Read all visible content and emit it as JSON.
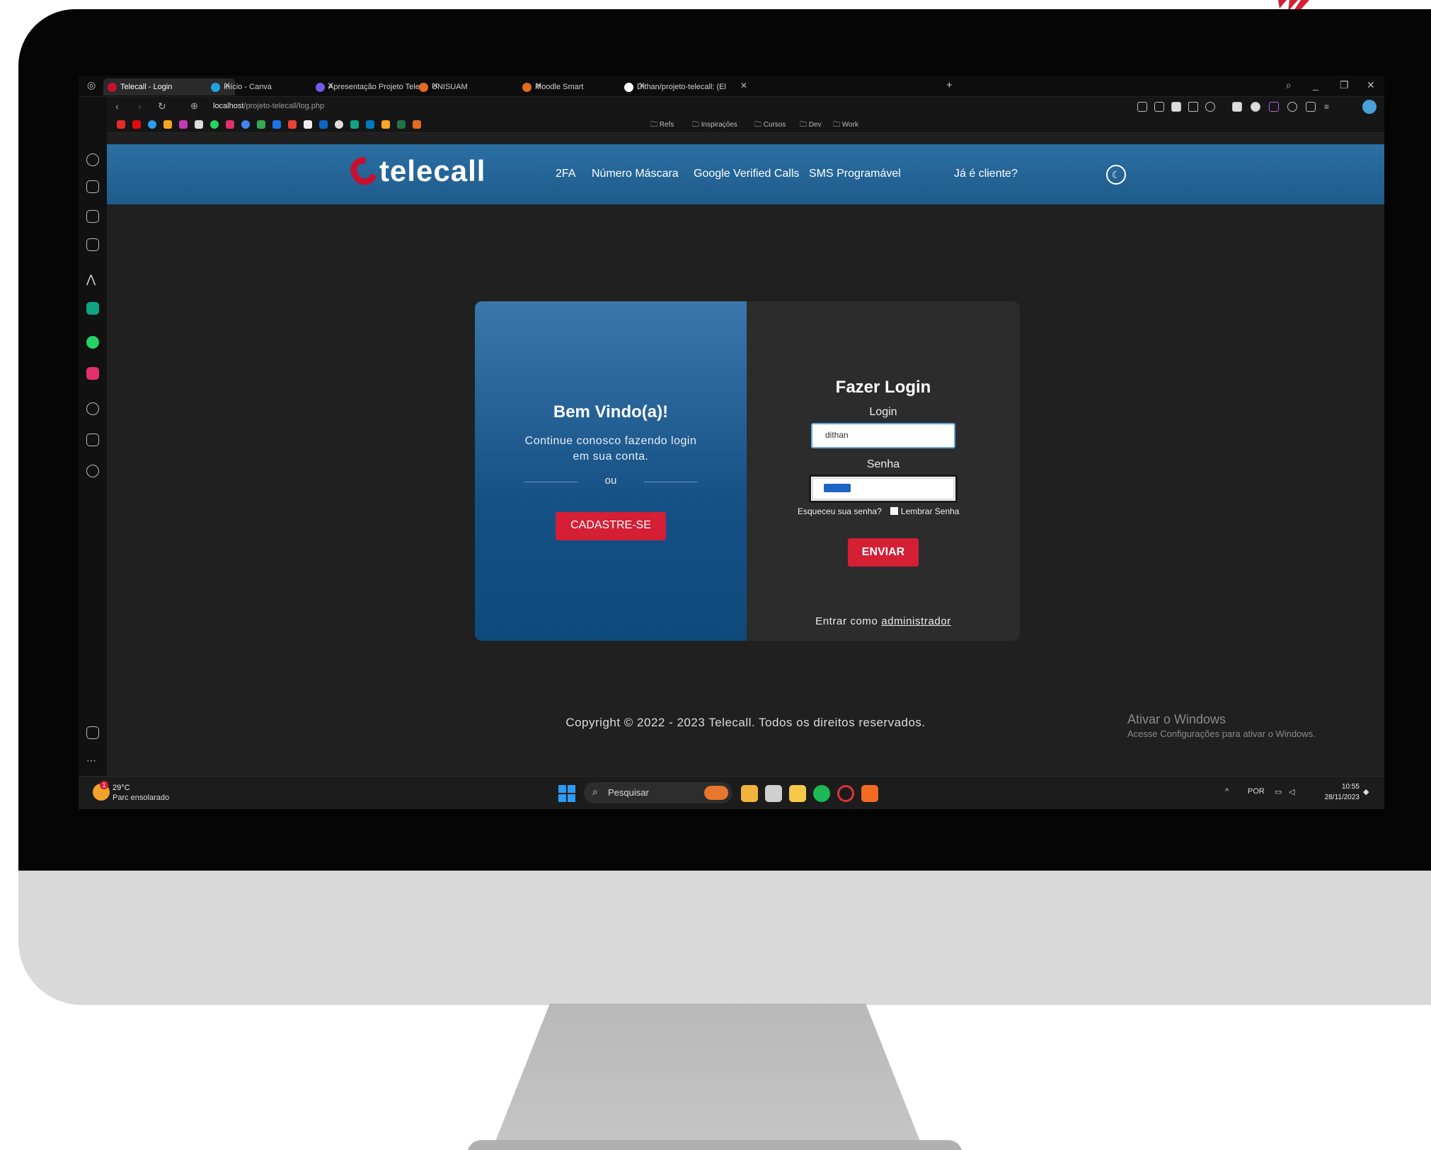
{
  "browser": {
    "tabs": [
      {
        "title": "Telecall - Login",
        "active": true,
        "favicon_color": "#c8102e"
      },
      {
        "title": "Início - Canva",
        "active": false,
        "favicon_color": "#1fa3e0"
      },
      {
        "title": "Apresentação Projeto Telec",
        "active": false,
        "favicon_color": "#6c5ce7"
      },
      {
        "title": "UNISUAM",
        "active": false,
        "favicon_color": "#e56b1f"
      },
      {
        "title": "Moodle Smart",
        "active": false,
        "favicon_color": "#e56b1f"
      },
      {
        "title": "Dithan/projeto-telecall: (El",
        "active": false,
        "favicon_color": "#ffffff"
      }
    ],
    "new_tab_glyph": "+",
    "url_host": "localhost",
    "url_path": "/projeto-telecall/log.php",
    "bookmark_folders": [
      "Refs",
      "Inspirações",
      "Cursos",
      "Dev",
      "Work"
    ]
  },
  "site": {
    "brand": "telecall",
    "nav": [
      "2FA",
      "Número Máscara",
      "Google Verified Calls",
      "SMS Programável"
    ],
    "client_link": "Já é cliente?",
    "brand_color": "#c8102e",
    "nav_color": "#2a6ea3"
  },
  "welcome": {
    "title": "Bem Vindo(a)!",
    "text": "Continue conosco fazendo login em sua conta.",
    "divider": "ou",
    "register_button": "CADASTRE-SE"
  },
  "login": {
    "title": "Fazer Login",
    "login_label": "Login",
    "login_value": "dithan",
    "password_label": "Senha",
    "forgot": "Esqueceu sua senha?",
    "remember": "Lembrar Senha",
    "submit": "ENVIAR",
    "admin_prefix": "Entrar como",
    "admin_link": "administrador"
  },
  "footer": {
    "copyright": "Copyright © 2022 - 2023 Telecall. Todos os direitos reservados."
  },
  "windows_activation": {
    "title": "Ativar o Windows",
    "subtitle": "Acesse Configurações para ativar o Windows."
  },
  "taskbar": {
    "weather_temp": "29°C",
    "weather_desc": "Parc ensolarado",
    "weather_badge": "1",
    "search_placeholder": "Pesquisar",
    "language": "POR",
    "time": "10:55",
    "date": "28/11/2023"
  }
}
